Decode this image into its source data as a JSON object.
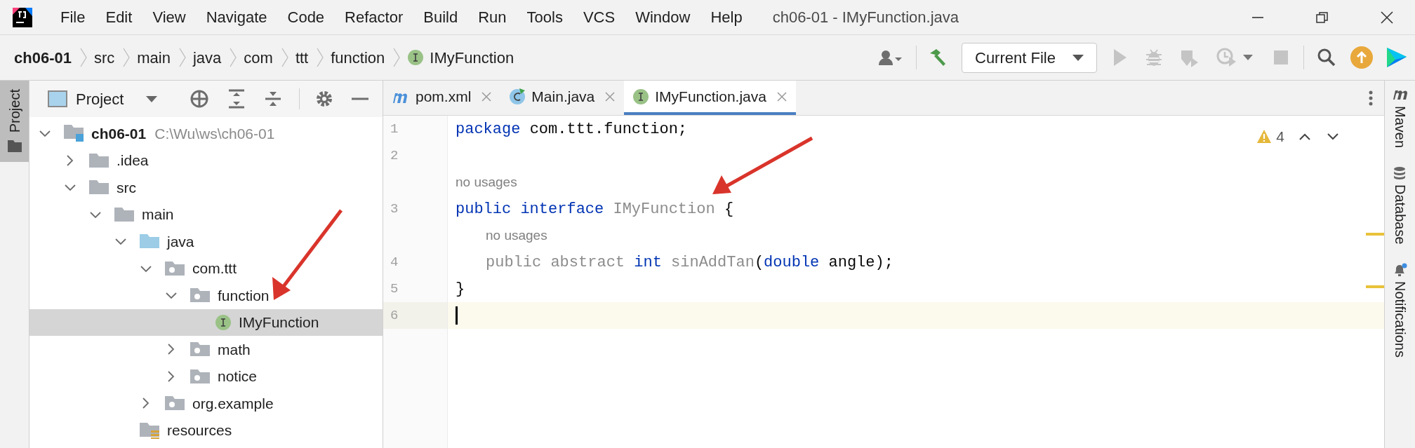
{
  "window": {
    "title": "ch06-01 - IMyFunction.java"
  },
  "menu": [
    {
      "label": "File"
    },
    {
      "label": "Edit"
    },
    {
      "label": "View"
    },
    {
      "label": "Navigate"
    },
    {
      "label": "Code"
    },
    {
      "label": "Refactor"
    },
    {
      "label": "Build"
    },
    {
      "label": "Run"
    },
    {
      "label": "Tools"
    },
    {
      "label": "VCS"
    },
    {
      "label": "Window"
    },
    {
      "label": "Help"
    }
  ],
  "breadcrumbs": [
    {
      "label": "ch06-01",
      "kind": "project"
    },
    {
      "label": "src",
      "kind": "plain"
    },
    {
      "label": "main",
      "kind": "plain"
    },
    {
      "label": "java",
      "kind": "plain"
    },
    {
      "label": "com",
      "kind": "plain"
    },
    {
      "label": "ttt",
      "kind": "plain"
    },
    {
      "label": "function",
      "kind": "plain"
    },
    {
      "label": "IMyFunction",
      "kind": "interface"
    }
  ],
  "run_config": {
    "label": "Current File"
  },
  "left_stripe": [
    {
      "label": "Project",
      "selected": true
    }
  ],
  "project": {
    "title": "Project",
    "tree": [
      {
        "label": "ch06-01",
        "kind": "module",
        "path": "C:\\Wu\\ws\\ch06-01",
        "expanded": true,
        "selected": false,
        "children": [
          {
            "label": ".idea",
            "kind": "folder",
            "expanded": false,
            "selected": false
          },
          {
            "label": "src",
            "kind": "folder",
            "expanded": true,
            "selected": false,
            "children": [
              {
                "label": "main",
                "kind": "folder",
                "expanded": true,
                "selected": false,
                "children": [
                  {
                    "label": "java",
                    "kind": "source-folder",
                    "expanded": true,
                    "selected": false,
                    "children": [
                      {
                        "label": "com.ttt",
                        "kind": "package",
                        "expanded": true,
                        "selected": false,
                        "children": [
                          {
                            "label": "function",
                            "kind": "package",
                            "expanded": true,
                            "selected": false,
                            "children": [
                              {
                                "label": "IMyFunction",
                                "kind": "interface",
                                "selected": true
                              }
                            ]
                          },
                          {
                            "label": "math",
                            "kind": "package",
                            "expanded": false,
                            "selected": false
                          },
                          {
                            "label": "notice",
                            "kind": "package",
                            "expanded": false,
                            "selected": false
                          }
                        ]
                      },
                      {
                        "label": "org.example",
                        "kind": "package",
                        "expanded": false,
                        "selected": false
                      }
                    ]
                  },
                  {
                    "label": "resources",
                    "kind": "resources-folder",
                    "selected": false
                  }
                ]
              }
            ]
          }
        ]
      }
    ]
  },
  "editor": {
    "tabs": [
      {
        "label": "pom.xml",
        "kind": "maven",
        "selected": false
      },
      {
        "label": "Main.java",
        "kind": "class",
        "selected": false
      },
      {
        "label": "IMyFunction.java",
        "kind": "interface",
        "selected": true
      }
    ],
    "warnings": "4",
    "lines": [
      {
        "kind": "code",
        "number": "1",
        "indented": false,
        "current": false,
        "tokens": [
          {
            "text": "package ",
            "kind": "keyword"
          },
          {
            "text": "com.ttt.function;",
            "kind": "plain"
          }
        ]
      },
      {
        "kind": "code",
        "number": "2",
        "current": false
      },
      {
        "kind": "hint",
        "text": "no usages",
        "indented": false
      },
      {
        "kind": "code",
        "number": "3",
        "indented": false,
        "current": false,
        "tokens": [
          {
            "text": "public ",
            "kind": "keyword"
          },
          {
            "text": "interface ",
            "kind": "keyword"
          },
          {
            "text": "IMyFunction ",
            "kind": "muted"
          },
          {
            "text": "{",
            "kind": "plain"
          }
        ]
      },
      {
        "kind": "hint",
        "text": "no usages",
        "indented": true
      },
      {
        "kind": "code",
        "number": "4",
        "indented": true,
        "current": false,
        "tokens": [
          {
            "text": "public abstract ",
            "kind": "muted"
          },
          {
            "text": "int ",
            "kind": "keyword"
          },
          {
            "text": "sinAddTan",
            "kind": "muted"
          },
          {
            "text": "(",
            "kind": "plain"
          },
          {
            "text": "double ",
            "kind": "keyword"
          },
          {
            "text": "angle);",
            "kind": "plain"
          }
        ]
      },
      {
        "kind": "code",
        "number": "5",
        "indented": false,
        "current": false,
        "tokens": [
          {
            "text": "}",
            "kind": "plain"
          }
        ]
      },
      {
        "kind": "code",
        "number": "6",
        "indented": false,
        "current": true
      }
    ]
  },
  "right_stripe": [
    {
      "label": "Maven",
      "kind": "maven"
    },
    {
      "label": "Database",
      "kind": "database"
    },
    {
      "label": "Notifications",
      "kind": "notifications"
    }
  ]
}
